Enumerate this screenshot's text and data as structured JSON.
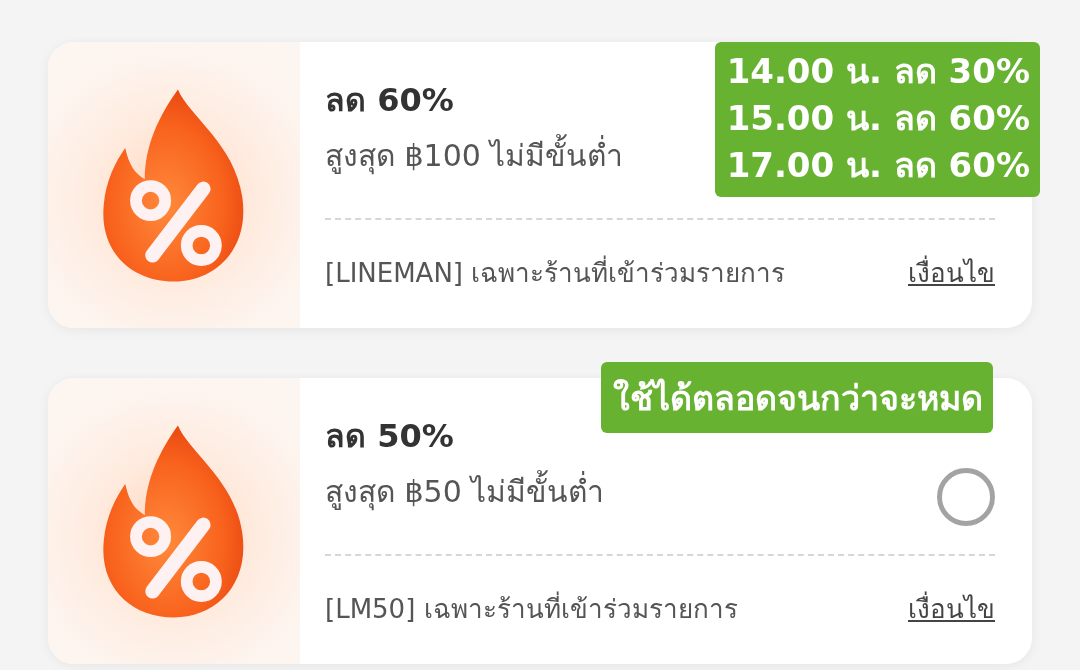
{
  "vouchers": [
    {
      "title": "ลด 60%",
      "subtitle": "สูงสุด ฿100 ไม่มีขั้นต่ำ",
      "terms": "[LINEMAN] เฉพาะร้านที่เข้าร่วมรายการ",
      "link": "เงื่อนไข",
      "sticker": {
        "kind": "schedule",
        "lines": [
          "14.00 น. ลด 30%",
          "15.00 น. ลด 60%",
          "17.00 น. ลด 60%"
        ]
      }
    },
    {
      "title": "ลด 50%",
      "subtitle": "สูงสุด ฿50 ไม่มีขั้นต่ำ",
      "terms": "[LM50] เฉพาะร้านที่เข้าร่วมรายการ",
      "link": "เงื่อนไข",
      "selected": false,
      "sticker": {
        "kind": "note",
        "lines": [
          "ใช้ได้ตลอดจนกว่าจะหมด"
        ]
      }
    }
  ]
}
